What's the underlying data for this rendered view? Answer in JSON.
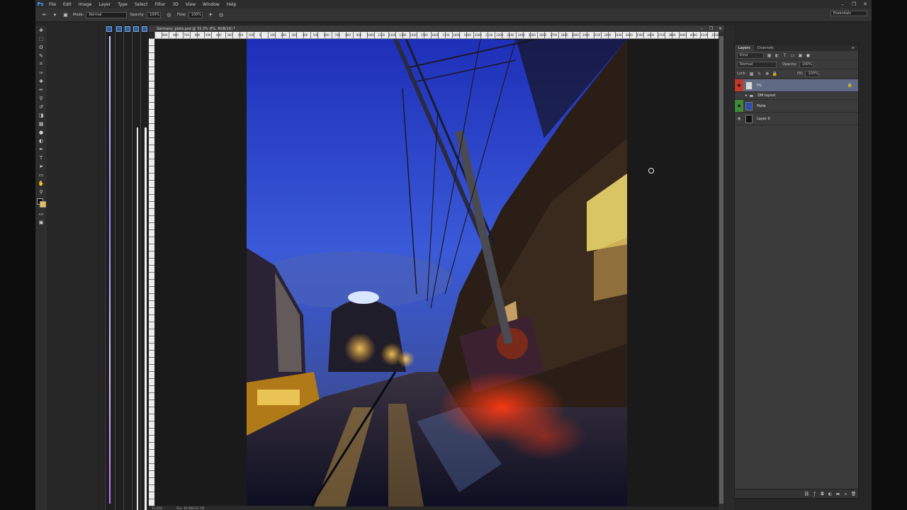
{
  "app": {
    "logo": "Ps"
  },
  "menu": [
    "File",
    "Edit",
    "Image",
    "Layer",
    "Type",
    "Select",
    "Filter",
    "3D",
    "View",
    "Window",
    "Help"
  ],
  "options": {
    "mode_label": "Mode:",
    "mode_value": "Normal",
    "opacity_label": "Opacity:",
    "opacity_value": "100%",
    "flow_label": "Flow:",
    "flow_value": "100%",
    "workspace": "Essentials"
  },
  "tools": [
    "move-tool",
    "marquee-tool",
    "lasso-tool",
    "quick-select-tool",
    "crop-tool",
    "eyedropper-tool",
    "healing-tool",
    "brush-tool",
    "clone-stamp-tool",
    "history-brush-tool",
    "eraser-tool",
    "gradient-tool",
    "blur-tool",
    "dodge-tool",
    "pen-tool",
    "type-tool",
    "path-select-tool",
    "shape-tool",
    "hand-tool",
    "zoom-tool"
  ],
  "tool_glyphs": [
    "✥",
    "⬚",
    "ʘ",
    "✎",
    "⌗",
    "✑",
    "✚",
    "✏",
    "⚲",
    "↺",
    "◨",
    "▦",
    "●",
    "◐",
    "✒",
    "T",
    "➤",
    "▭",
    "✋",
    "⚲"
  ],
  "document": {
    "title": "Germany_plate.psd @ 33.3% (FG, RGB/16) *",
    "zoom": "33.33%",
    "doc_size": "Doc: 65.9M/211.1M",
    "ruler_labels": [
      "900",
      "800",
      "700",
      "600",
      "500",
      "400",
      "300",
      "200",
      "100",
      "0",
      "100",
      "200",
      "300",
      "400",
      "500",
      "600",
      "700",
      "800",
      "900",
      "1000",
      "1100",
      "1200",
      "1300",
      "1400",
      "1500",
      "1600",
      "1700",
      "1800",
      "1900",
      "2000",
      "2100",
      "2200",
      "2300",
      "2400",
      "2500",
      "2600",
      "2700",
      "2800",
      "2900",
      "3000",
      "3100",
      "3200",
      "3300",
      "3400",
      "3500",
      "3600",
      "3700",
      "3800",
      "3900",
      "4000",
      "4100",
      "4200"
    ]
  },
  "layers_panel": {
    "tabs": [
      "Layers",
      "Channels"
    ],
    "filter_kind": "Kind",
    "blend_mode": "Normal",
    "opacity_label": "Opacity:",
    "opacity_value": "100%",
    "lock_label": "Lock:",
    "fill_label": "Fill:",
    "fill_value": "100%",
    "layers": [
      {
        "name": "FG",
        "visible": true,
        "selected": true,
        "locked": true,
        "thumb": "#d8d8d8"
      },
      {
        "name": "DM layout",
        "visible": false,
        "selected": false,
        "group": true
      },
      {
        "name": "Plate",
        "visible": true,
        "selected": false,
        "thumb": "#2b4cb0"
      },
      {
        "name": "Layer 0",
        "visible": false,
        "selected": false,
        "thumb": "#111111"
      }
    ]
  },
  "colors": {
    "foreground": "#111111",
    "background": "#e6c04a",
    "selection": "#5f6a85"
  }
}
